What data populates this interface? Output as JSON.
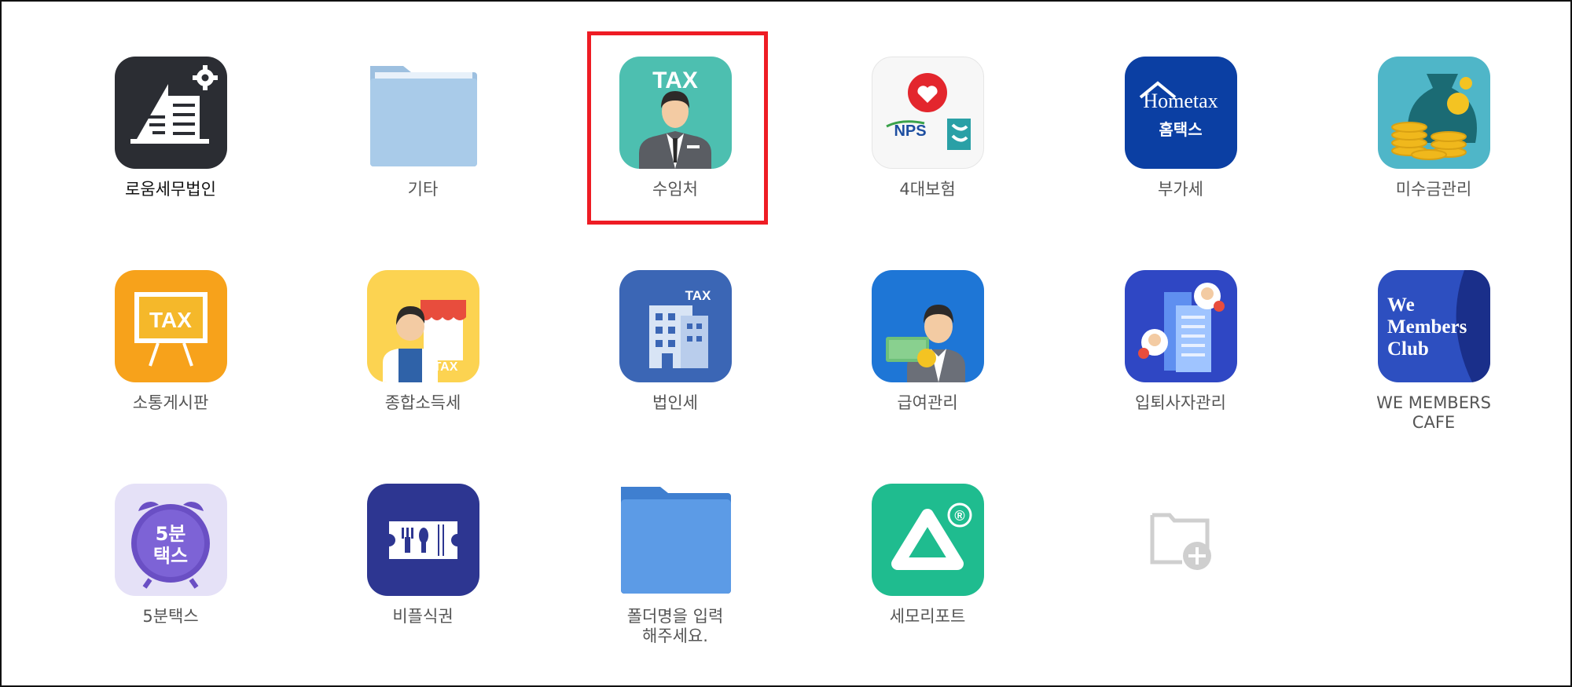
{
  "apps": [
    {
      "id": "roum",
      "label": "로움세무법인",
      "icon": "building-settings-icon"
    },
    {
      "id": "other",
      "label": "기타",
      "icon": "folder-icon"
    },
    {
      "id": "clients",
      "label": "수임처",
      "icon": "tax-person-icon",
      "icon_text": "TAX",
      "highlighted": true
    },
    {
      "id": "insurance",
      "label": "4대보험",
      "icon": "nps-icon",
      "icon_text": "NPS"
    },
    {
      "id": "vat",
      "label": "부가세",
      "icon": "hometax-icon",
      "icon_text": "Hometax",
      "icon_text2": "홈택스"
    },
    {
      "id": "receivables",
      "label": "미수금관리",
      "icon": "money-bag-icon"
    },
    {
      "id": "board",
      "label": "소통게시판",
      "icon": "tax-board-icon",
      "icon_text": "TAX"
    },
    {
      "id": "income-tax",
      "label": "종합소득세",
      "icon": "shop-owner-icon",
      "icon_text": "TAX"
    },
    {
      "id": "corp-tax",
      "label": "법인세",
      "icon": "corporate-building-icon",
      "icon_text": "TAX"
    },
    {
      "id": "payroll",
      "label": "급여관리",
      "icon": "payroll-person-icon"
    },
    {
      "id": "hr",
      "label": "입퇴사자관리",
      "icon": "employee-building-icon"
    },
    {
      "id": "we-members",
      "label_lines": [
        "WE MEMBERS",
        "CAFE"
      ],
      "icon": "we-members-club-icon",
      "icon_lines": [
        "We",
        "Members",
        "Club"
      ]
    },
    {
      "id": "5min-tax",
      "label": "5분택스",
      "icon": "alarm-clock-icon",
      "icon_lines": [
        "5분",
        "택스"
      ]
    },
    {
      "id": "meal",
      "label": "비플식권",
      "icon": "meal-ticket-icon"
    },
    {
      "id": "new-folder",
      "label_lines": [
        "폴더명을 입력",
        "해주세요."
      ],
      "icon": "blue-folder-icon"
    },
    {
      "id": "semo-report",
      "label": "세모리포트",
      "icon": "semo-triangle-icon",
      "icon_text": "®"
    },
    {
      "id": "add-folder",
      "icon": "add-folder-icon"
    }
  ]
}
